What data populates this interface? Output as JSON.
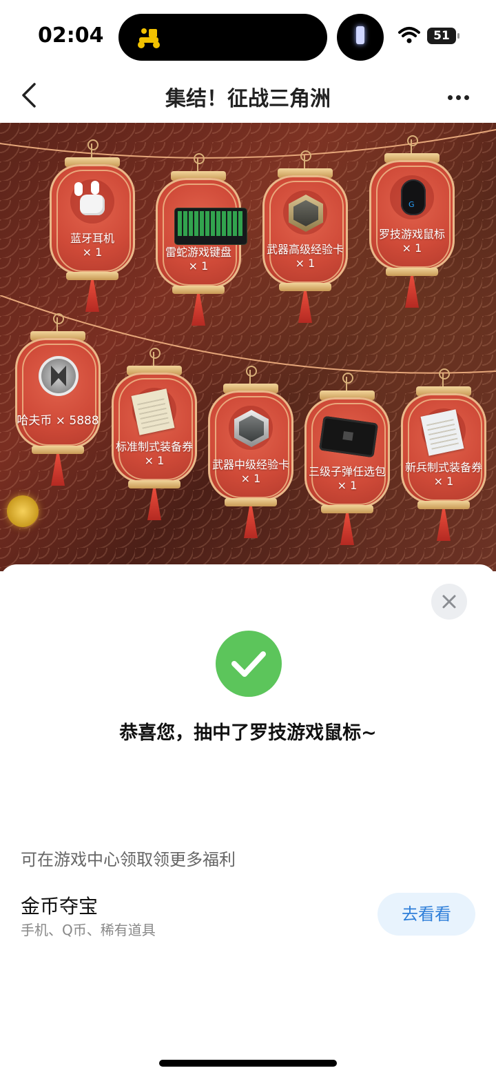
{
  "status_bar": {
    "time": "02:04",
    "battery": "51"
  },
  "header": {
    "title": "集结！征战三角洲"
  },
  "prizes": [
    {
      "name": "蓝牙耳机",
      "qty": "× 1"
    },
    {
      "name": "雷蛇游戏键盘",
      "qty": "× 1"
    },
    {
      "name": "武器高级经验卡",
      "qty": "× 1"
    },
    {
      "name": "罗技游戏鼠标",
      "qty": "× 1"
    },
    {
      "name": "哈夫币 × 5888",
      "qty": ""
    },
    {
      "name": "标准制式装备券",
      "qty": "× 1"
    },
    {
      "name": "武器中级经验卡",
      "qty": "× 1"
    },
    {
      "name": "三级子弹任选包",
      "qty": "× 1"
    },
    {
      "name": "新兵制式装备券",
      "qty": "× 1"
    }
  ],
  "sheet": {
    "congrats": "恭喜您，抽中了罗技游戏鼠标~",
    "hint": "可在游戏中心领取领更多福利",
    "promo_title": "金币夺宝",
    "promo_sub": "手机、Q币、稀有道具",
    "go_label": "去看看"
  },
  "colors": {
    "accent": "#5cc55b",
    "link": "#2f7fd9",
    "lantern": "#cf4a38"
  }
}
